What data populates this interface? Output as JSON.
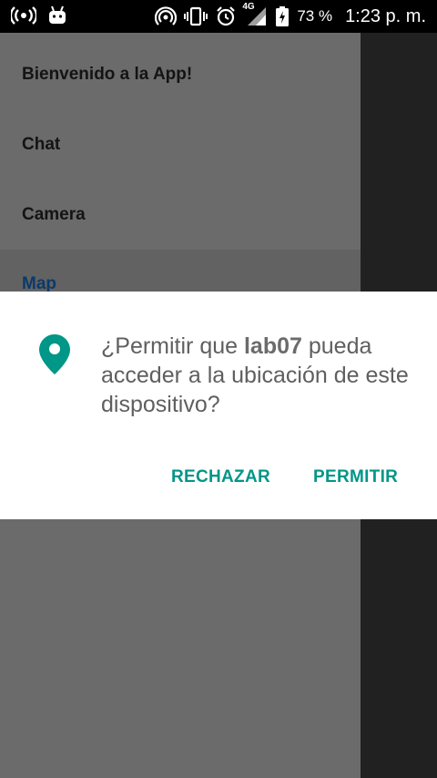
{
  "status_bar": {
    "icons_left": [
      "hotspot-icon",
      "android-icon"
    ],
    "icons_right": [
      "wifi-calling-icon",
      "vibrate-icon",
      "alarm-icon",
      "signal-4g-icon",
      "battery-charging-icon"
    ],
    "network_label": "4G",
    "battery_percent": "73 %",
    "time": "1:23 p. m."
  },
  "drawer": {
    "items": [
      {
        "label": "Bienvenido a la App!"
      },
      {
        "label": "Chat"
      },
      {
        "label": "Camera"
      },
      {
        "label": "Map"
      }
    ],
    "selected_index": 3
  },
  "permission_dialog": {
    "icon": "location-pin-icon",
    "icon_color": "#009688",
    "message_prefix": "¿Permitir que ",
    "app_name": "lab07",
    "message_suffix": " pueda acceder a la ubicación de este dispositivo?",
    "deny_label": "RECHAZAR",
    "allow_label": "PERMITIR",
    "accent_color": "#009688"
  }
}
